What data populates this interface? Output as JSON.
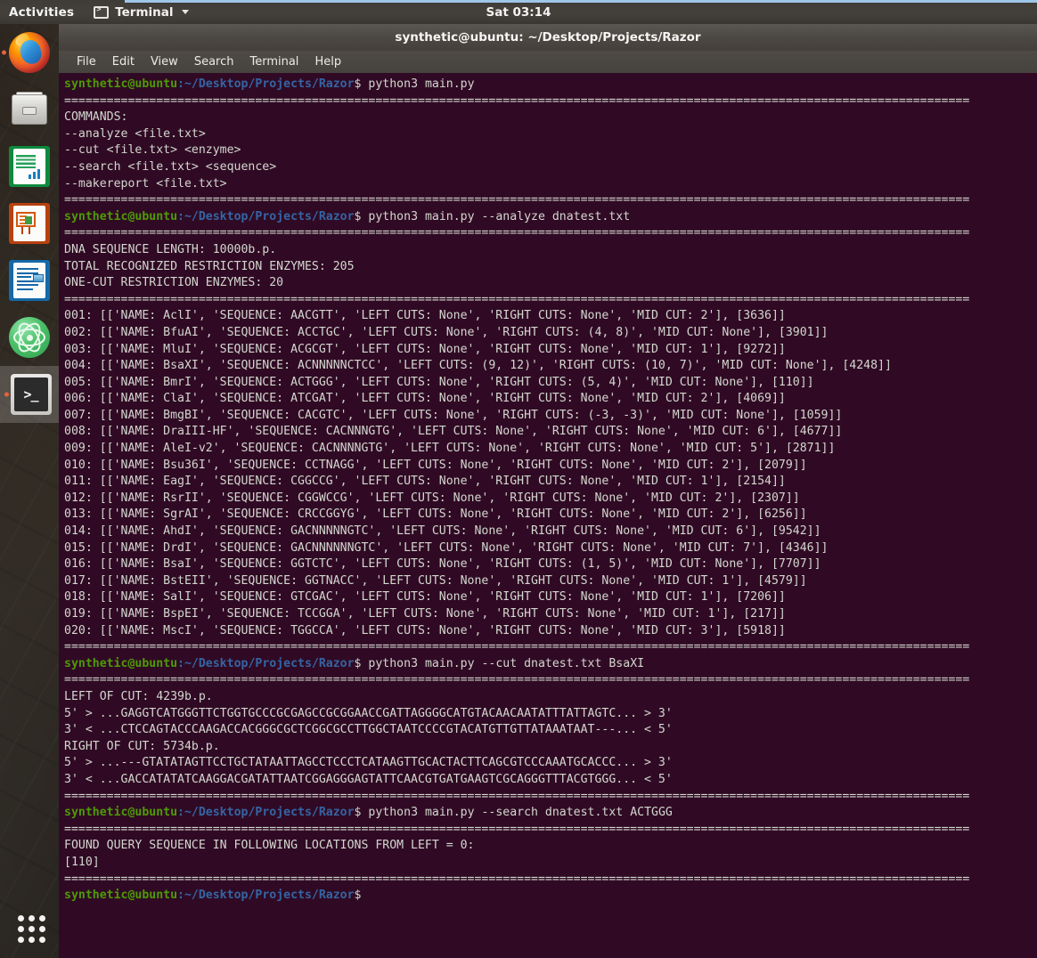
{
  "desktop": {
    "top_panel": {
      "activities_label": "Activities",
      "app_name": "Terminal",
      "clock": "Sat 03:14",
      "terminal_icon": "terminal-icon",
      "caret_icon": "chevron-down-icon"
    },
    "dock": {
      "items": [
        {
          "name": "firefox",
          "label": "Firefox Web Browser",
          "running": true,
          "active": false
        },
        {
          "name": "files",
          "label": "Files",
          "running": false,
          "active": false
        },
        {
          "name": "calc",
          "label": "LibreOffice Calc",
          "running": false,
          "active": false
        },
        {
          "name": "impress",
          "label": "LibreOffice Impress",
          "running": false,
          "active": false
        },
        {
          "name": "writer",
          "label": "LibreOffice Writer",
          "running": false,
          "active": false
        },
        {
          "name": "atom",
          "label": "Atom",
          "running": false,
          "active": false
        },
        {
          "name": "terminal",
          "label": "Terminal",
          "running": true,
          "active": true
        }
      ],
      "show_applications_label": "Show Applications"
    }
  },
  "window": {
    "title": "synthetic@ubuntu: ~/Desktop/Projects/Razor",
    "menu": [
      "File",
      "Edit",
      "View",
      "Search",
      "Terminal",
      "Help"
    ]
  },
  "terminal": {
    "colors": {
      "background": "#300a24",
      "foreground": "#d3d7cf",
      "user_host": "#4e9a06",
      "path": "#3465a4"
    },
    "prompt": {
      "user_host": "synthetic@ubuntu",
      "path": ":~/Desktop/Projects/Razor",
      "symbol": "$"
    },
    "separator": "================================================================================================================================",
    "commands": [
      "python3 main.py",
      "python3 main.py --analyze dnatest.txt",
      "python3 main.py --cut dnatest.txt BsaXI",
      "python3 main.py --search dnatest.txt ACTGGG"
    ],
    "help_output": [
      "COMMANDS:",
      "--analyze <file.txt>",
      "--cut <file.txt> <enzyme>",
      "--search <file.txt> <sequence>",
      "--makereport <file.txt>"
    ],
    "analyze_summary": [
      "DNA SEQUENCE LENGTH: 10000b.p.",
      "TOTAL RECOGNIZED RESTRICTION ENZYMES: 205",
      "ONE-CUT RESTRICTION ENZYMES: 20"
    ],
    "enzymes": [
      {
        "index": "001",
        "name": "AclI",
        "sequence": "AACGTT",
        "left_cuts": "None",
        "right_cuts": "None",
        "mid_cut": "2",
        "position": "3636"
      },
      {
        "index": "002",
        "name": "BfuAI",
        "sequence": "ACCTGC",
        "left_cuts": "None",
        "right_cuts": "(4, 8)",
        "mid_cut": "None",
        "position": "3901"
      },
      {
        "index": "003",
        "name": "MluI",
        "sequence": "ACGCGT",
        "left_cuts": "None",
        "right_cuts": "None",
        "mid_cut": "1",
        "position": "9272"
      },
      {
        "index": "004",
        "name": "BsaXI",
        "sequence": "ACNNNNNCTCC",
        "left_cuts": "(9, 12)",
        "right_cuts": "(10, 7)",
        "mid_cut": "None",
        "position": "4248"
      },
      {
        "index": "005",
        "name": "BmrI",
        "sequence": "ACTGGG",
        "left_cuts": "None",
        "right_cuts": "(5, 4)",
        "mid_cut": "None",
        "position": "110"
      },
      {
        "index": "006",
        "name": "ClaI",
        "sequence": "ATCGAT",
        "left_cuts": "None",
        "right_cuts": "None",
        "mid_cut": "2",
        "position": "4069"
      },
      {
        "index": "007",
        "name": "BmgBI",
        "sequence": "CACGTC",
        "left_cuts": "None",
        "right_cuts": "(-3, -3)",
        "mid_cut": "None",
        "position": "1059"
      },
      {
        "index": "008",
        "name": "DraIII-HF",
        "sequence": "CACNNNGTG",
        "left_cuts": "None",
        "right_cuts": "None",
        "mid_cut": "6",
        "position": "4677"
      },
      {
        "index": "009",
        "name": "AleI-v2",
        "sequence": "CACNNNNGTG",
        "left_cuts": "None",
        "right_cuts": "None",
        "mid_cut": "5",
        "position": "2871"
      },
      {
        "index": "010",
        "name": "Bsu36I",
        "sequence": "CCTNAGG",
        "left_cuts": "None",
        "right_cuts": "None",
        "mid_cut": "2",
        "position": "2079"
      },
      {
        "index": "011",
        "name": "EagI",
        "sequence": "CGGCCG",
        "left_cuts": "None",
        "right_cuts": "None",
        "mid_cut": "1",
        "position": "2154"
      },
      {
        "index": "012",
        "name": "RsrII",
        "sequence": "CGGWCCG",
        "left_cuts": "None",
        "right_cuts": "None",
        "mid_cut": "2",
        "position": "2307"
      },
      {
        "index": "013",
        "name": "SgrAI",
        "sequence": "CRCCGGYG",
        "left_cuts": "None",
        "right_cuts": "None",
        "mid_cut": "2",
        "position": "6256"
      },
      {
        "index": "014",
        "name": "AhdI",
        "sequence": "GACNNNNNGTC",
        "left_cuts": "None",
        "right_cuts": "None",
        "mid_cut": "6",
        "position": "9542"
      },
      {
        "index": "015",
        "name": "DrdI",
        "sequence": "GACNNNNNNGTC",
        "left_cuts": "None",
        "right_cuts": "None",
        "mid_cut": "7",
        "position": "4346"
      },
      {
        "index": "016",
        "name": "BsaI",
        "sequence": "GGTCTC",
        "left_cuts": "None",
        "right_cuts": "(1, 5)",
        "mid_cut": "None",
        "position": "7707"
      },
      {
        "index": "017",
        "name": "BstEII",
        "sequence": "GGTNACC",
        "left_cuts": "None",
        "right_cuts": "None",
        "mid_cut": "1",
        "position": "4579"
      },
      {
        "index": "018",
        "name": "SalI",
        "sequence": "GTCGAC",
        "left_cuts": "None",
        "right_cuts": "None",
        "mid_cut": "1",
        "position": "7206"
      },
      {
        "index": "019",
        "name": "BspEI",
        "sequence": "TCCGGA",
        "left_cuts": "None",
        "right_cuts": "None",
        "mid_cut": "1",
        "position": "217"
      },
      {
        "index": "020",
        "name": "MscI",
        "sequence": "TGGCCA",
        "left_cuts": "None",
        "right_cuts": "None",
        "mid_cut": "3",
        "position": "5918"
      }
    ],
    "cut_output": {
      "left_label": "LEFT OF CUT: 4239b.p.",
      "left_strand_5": "5' > ...GAGGTCATGGGTTCTGGTGCCCGCGAGCCGCGGAACCGATTAGGGGCATGTACAACAATATTTATTAGTC... > 3'",
      "left_strand_3": "3' < ...CTCCAGTACCCAAGACCACGGGCGCTCGGCGCCTTGGCTAATCCCCGTACATGTTGTTATAAATAAT---... < 5'",
      "right_label": "RIGHT OF CUT: 5734b.p.",
      "right_strand_5": "5' > ...---GTATATAGTTCCTGCTATAATTAGCCTCCCTCATAAGTTGCACTACTTCAGCGTCCCAAATGCACCC... > 3'",
      "right_strand_3": "3' < ...GACCATATATCAAGGACGATATTAATCGGAGGGAGTATTCAACGTGATGAAGTCGCAGGGTTTACGTGGG... < 5'"
    },
    "search_output": {
      "header": "FOUND QUERY SEQUENCE IN FOLLOWING LOCATIONS FROM LEFT = 0:",
      "locations": "[110]"
    }
  }
}
